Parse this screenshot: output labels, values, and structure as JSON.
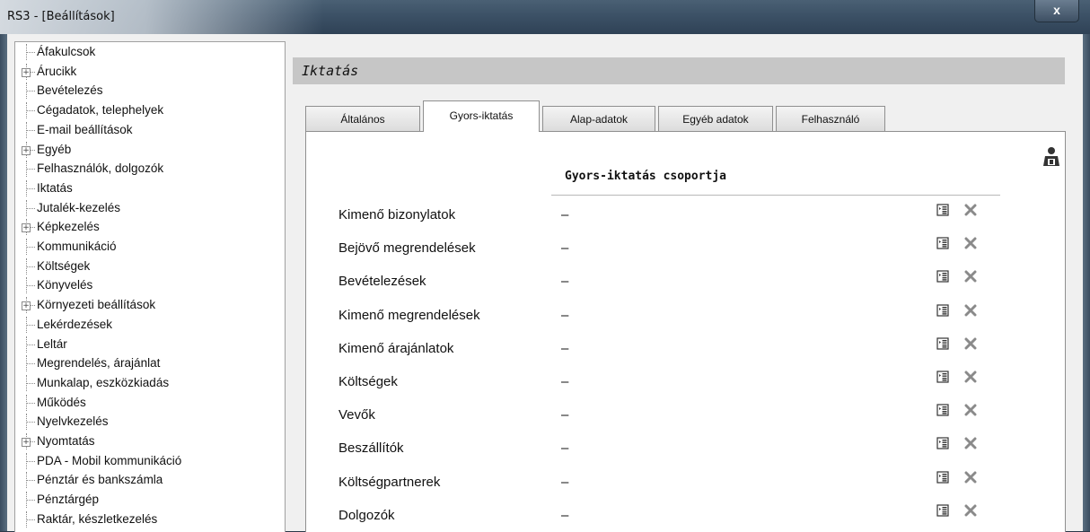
{
  "window": {
    "title": "RS3 - [Beállítások]",
    "close_label": "x"
  },
  "tree": {
    "items": [
      {
        "label": "Áfakulcsok",
        "expandable": false
      },
      {
        "label": "Árucikk",
        "expandable": true
      },
      {
        "label": "Bevételezés",
        "expandable": false
      },
      {
        "label": "Cégadatok, telephelyek",
        "expandable": false
      },
      {
        "label": "E-mail beállítások",
        "expandable": false
      },
      {
        "label": "Egyéb",
        "expandable": true
      },
      {
        "label": "Felhasználók, dolgozók",
        "expandable": false
      },
      {
        "label": "Iktatás",
        "expandable": false,
        "selected": true
      },
      {
        "label": "Jutalék-kezelés",
        "expandable": false
      },
      {
        "label": "Képkezelés",
        "expandable": true
      },
      {
        "label": "Kommunikáció",
        "expandable": false
      },
      {
        "label": "Költségek",
        "expandable": false
      },
      {
        "label": "Könyvelés",
        "expandable": false
      },
      {
        "label": "Környezeti beállítások",
        "expandable": true
      },
      {
        "label": "Lekérdezések",
        "expandable": false
      },
      {
        "label": "Leltár",
        "expandable": false
      },
      {
        "label": "Megrendelés, árajánlat",
        "expandable": false
      },
      {
        "label": "Munkalap, eszközkiadás",
        "expandable": false
      },
      {
        "label": "Működés",
        "expandable": false
      },
      {
        "label": "Nyelvkezelés",
        "expandable": false
      },
      {
        "label": "Nyomtatás",
        "expandable": true
      },
      {
        "label": "PDA - Mobil kommunikáció",
        "expandable": false
      },
      {
        "label": "Pénztár és bankszámla",
        "expandable": false
      },
      {
        "label": "Pénztárgép",
        "expandable": false
      },
      {
        "label": "Raktár, készletkezelés",
        "expandable": false
      }
    ]
  },
  "main": {
    "section_title": "Iktatás",
    "tabs": [
      {
        "label": "Általános"
      },
      {
        "label": "Gyors-iktatás",
        "active": true
      },
      {
        "label": "Alap-adatok"
      },
      {
        "label": "Egyéb adatok"
      },
      {
        "label": "Felhasználó"
      }
    ],
    "group_title": "Gyors-iktatás csoportja",
    "rows": [
      {
        "label": "Kimenő bizonylatok",
        "value": "–"
      },
      {
        "label": "Bejövő megrendelések",
        "value": "–"
      },
      {
        "label": "Bevételezések",
        "value": "–"
      },
      {
        "label": "Kimenő megrendelések",
        "value": "–"
      },
      {
        "label": "Kimenő árajánlatok",
        "value": "–"
      },
      {
        "label": "Költségek",
        "value": "–"
      },
      {
        "label": "Vevők",
        "value": "–"
      },
      {
        "label": "Beszállítók",
        "value": "–"
      },
      {
        "label": "Költségpartnerek",
        "value": "–"
      },
      {
        "label": "Dolgozók",
        "value": "–"
      }
    ]
  },
  "icons": {
    "top_right": "user-permissions-icon",
    "row_select": "select-list-icon",
    "row_clear": "clear-x-icon"
  }
}
